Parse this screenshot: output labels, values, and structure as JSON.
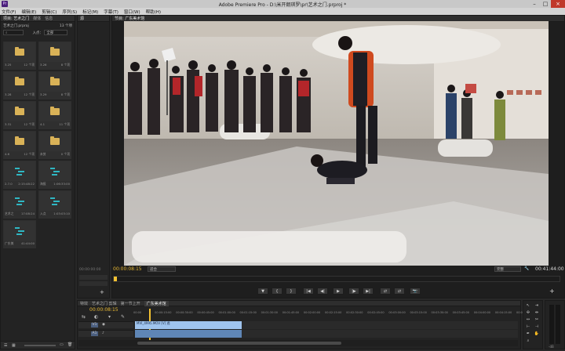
{
  "window": {
    "title": "Adobe Premiere Pro - D:\\米开朗琪罗\\pr\\艺术之门.prproj *",
    "app_icon": "Pr"
  },
  "menu": [
    "文件(F)",
    "编辑(E)",
    "剪辑(C)",
    "序列(S)",
    "标记(M)",
    "字幕(T)",
    "窗口(W)",
    "帮助(H)"
  ],
  "project_panel": {
    "tabs": [
      "项目: 艺术之门",
      "媒体",
      "信息",
      "效果"
    ],
    "project_file": "艺术之门.prproj",
    "item_count": "13 个项",
    "search_label": "入点：",
    "search_value": "全部",
    "bins": [
      {
        "name": "3.25",
        "count": "12 个项",
        "kind": "folder"
      },
      {
        "name": "3.26",
        "count": "8 个项",
        "kind": "folder"
      },
      {
        "name": "3.28",
        "count": "12 个项",
        "kind": "folder"
      },
      {
        "name": "3.29",
        "count": "8 个项",
        "kind": "folder"
      },
      {
        "name": "3.31",
        "count": "12 个项",
        "kind": "folder"
      },
      {
        "name": "4.1",
        "count": "11 个项",
        "kind": "folder"
      },
      {
        "name": "4.6",
        "count": "12 个项",
        "kind": "folder"
      },
      {
        "name": "未剪",
        "count": "0 个项",
        "kind": "folder"
      },
      {
        "name": "2.7.0",
        "count": "2:15:48:22",
        "kind": "sequence"
      },
      {
        "name": "海报",
        "count": "1:06:33:00",
        "kind": "sequence"
      },
      {
        "name": "艺术之",
        "count": "17:08:24",
        "kind": "sequence"
      },
      {
        "name": "入点",
        "count": "1:03:03:10",
        "kind": "sequence"
      },
      {
        "name": "广东美",
        "count": "41:44:00",
        "kind": "sequence"
      }
    ]
  },
  "source_panel": {
    "timecode_left": "00:00:00:00"
  },
  "program_monitor": {
    "tabs": [
      "节目: 广东美术馆"
    ],
    "current_time": "00:00:08:15",
    "fit_label": "适合",
    "quality_label": "完整",
    "duration": "00:41:44:00",
    "controls": [
      "▼",
      "{",
      "}",
      "|◀",
      "◀|",
      "▶",
      "|▶",
      "▶|",
      "⇄",
      "⇄",
      "📷"
    ]
  },
  "timeline": {
    "tabs": [
      "特效",
      "艺术之门 剪辑",
      "第一节上开",
      "广东美术馆"
    ],
    "active_tab": "广东美术馆",
    "current_time": "00:00:08:15",
    "ruler": [
      "00:00",
      "00:00:15:00",
      "00:00:30:00",
      "00:00:45:00",
      "00:01:00:00",
      "00:01:15:00",
      "00:01:30:00",
      "00:01:45:00",
      "00:02:00:00",
      "00:02:15:00",
      "00:02:30:00",
      "00:02:45:00",
      "00:03:00:00",
      "00:03:15:00",
      "00:03:30:00",
      "00:03:45:00",
      "00:04:00:00",
      "00:04:15:00",
      "00:04:30:00"
    ],
    "tracks": [
      {
        "id": "V1",
        "clip": "MVI_4995.MOV [V] 透"
      },
      {
        "id": "A1",
        "clip": ""
      }
    ],
    "zoom_label": "-dB"
  },
  "colors": {
    "accent": "#e7b832",
    "clip_video": "#9fc4ee",
    "clip_audio": "#5f86b6",
    "playhead": "#f3c232"
  }
}
